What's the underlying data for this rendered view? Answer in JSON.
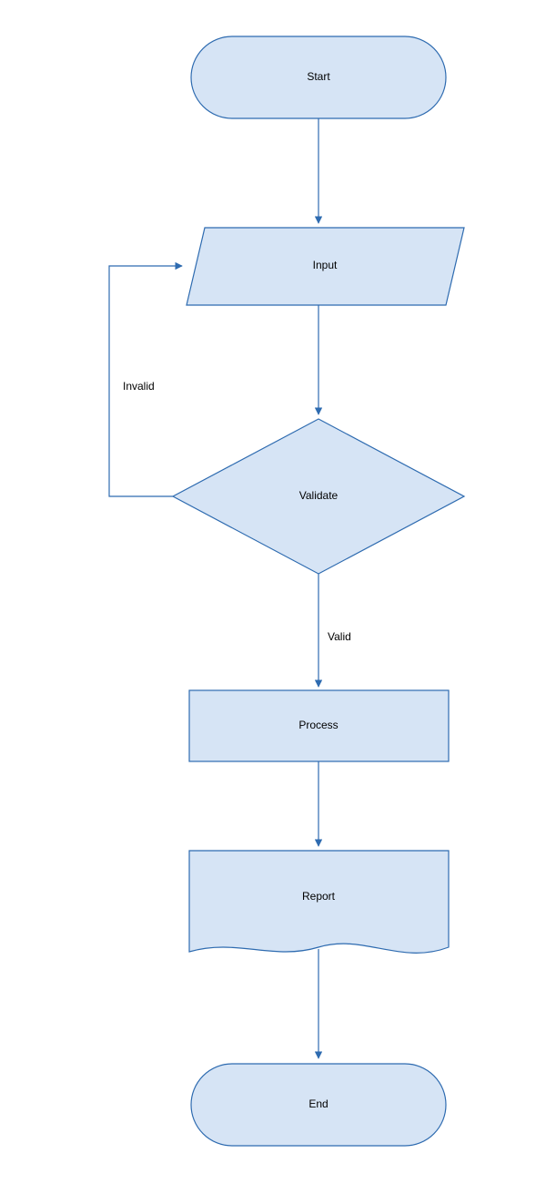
{
  "diagram": {
    "type": "flowchart",
    "nodes": {
      "start": {
        "label": "Start"
      },
      "input": {
        "label": "Input"
      },
      "validate": {
        "label": "Validate"
      },
      "process": {
        "label": "Process"
      },
      "report": {
        "label": "Report"
      },
      "end": {
        "label": "End"
      }
    },
    "edges": {
      "invalid": {
        "label": "Invalid"
      },
      "valid": {
        "label": "Valid"
      }
    },
    "colors": {
      "fill": "#d6e4f5",
      "stroke": "#2e6bb0"
    }
  }
}
